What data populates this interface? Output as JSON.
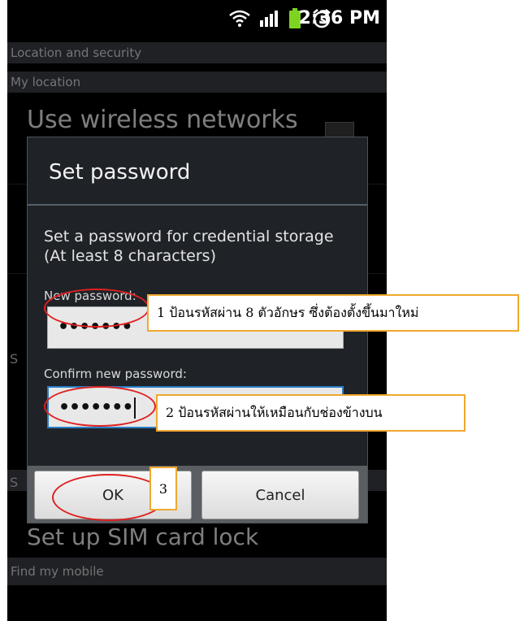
{
  "status_bar": {
    "time": "2:36 PM",
    "icons": [
      "wifi-icon",
      "signal-icon",
      "battery-icon",
      "alarm-icon"
    ]
  },
  "background": {
    "header_location_security": "Location and security",
    "header_my_location": "My location",
    "item_wireless": "Use wireless networks",
    "letter_s1": "S",
    "letter_s2": "S",
    "item_sim_lock": "Set up SIM card lock",
    "header_find_mobile": "Find my mobile"
  },
  "dialog": {
    "title": "Set password",
    "message": "Set a password for credential storage (At least 8 characters)",
    "new_password_label": "New password:",
    "new_password_value": "•••••••",
    "confirm_password_label": "Confirm new password:",
    "confirm_password_value": "•••••••",
    "ok_label": "OK",
    "cancel_label": "Cancel"
  },
  "annotations": {
    "callout_1": "1 ป้อนรหัสผ่าน 8 ตัวอักษร ซึ่งต้องตั้งขึ้นมาใหม่",
    "callout_2": "2 ป้อนรหัสผ่านให้เหมือนกับช่องข้างบน",
    "callout_3": "3"
  },
  "colors": {
    "ellipse": "#e02020",
    "callout_border": "#f0a830",
    "focus": "#2a7fc5"
  }
}
